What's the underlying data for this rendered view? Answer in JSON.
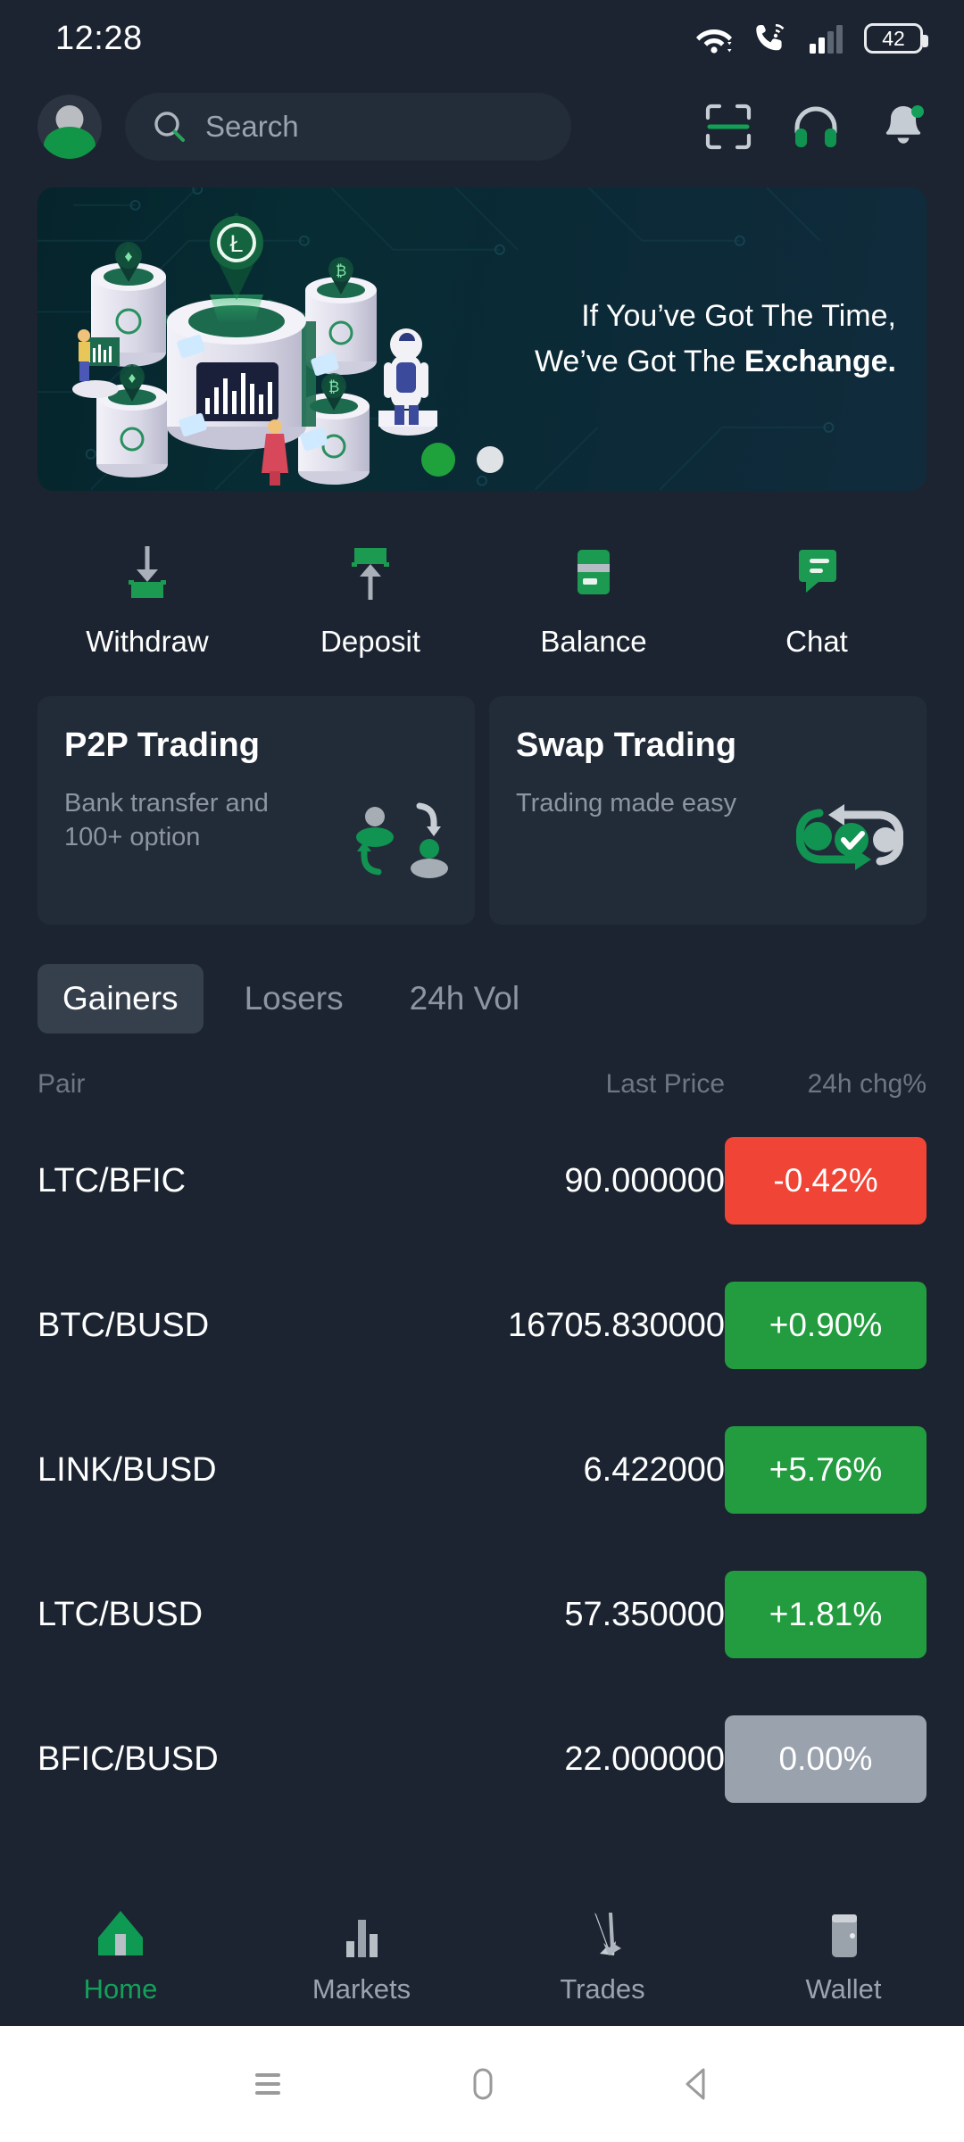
{
  "statusbar": {
    "time": "12:28",
    "battery_level": "42",
    "icons": [
      "wifi-icon",
      "vowifi-call-icon",
      "cellular-signal-icon",
      "battery-icon"
    ]
  },
  "topbar": {
    "avatar": "user-avatar",
    "search": {
      "placeholder": "Search",
      "value": ""
    },
    "actions": [
      {
        "name": "scan-icon",
        "label": "Scan"
      },
      {
        "name": "headphones-support-icon",
        "label": "Support"
      },
      {
        "name": "bell-notification-icon",
        "label": "Notifications",
        "has_badge": true
      }
    ]
  },
  "banner": {
    "line1": "If You’ve Got The Time,",
    "line2_prefix": "We’ve Got The ",
    "line2_strong": "Exchange.",
    "dots": [
      {
        "state": "active",
        "color": "#1fa23c"
      },
      {
        "state": "inactive",
        "color": "#dfe3e6"
      }
    ]
  },
  "quick_actions": [
    {
      "label": "Withdraw",
      "icon": "withdraw-icon"
    },
    {
      "label": "Deposit",
      "icon": "deposit-icon"
    },
    {
      "label": "Balance",
      "icon": "balance-card-icon"
    },
    {
      "label": "Chat",
      "icon": "chat-bubble-icon"
    }
  ],
  "promos": [
    {
      "title": "P2P Trading",
      "subtitle": "Bank transfer and 100+ option",
      "icon": "p2p-exchange-icon"
    },
    {
      "title": "Swap Trading",
      "subtitle": "Trading made easy",
      "icon": "swap-arrows-icon"
    }
  ],
  "market": {
    "tabs": [
      {
        "label": "Gainers",
        "active": true
      },
      {
        "label": "Losers",
        "active": false
      },
      {
        "label": "24h Vol",
        "active": false
      }
    ],
    "columns": {
      "pair": "Pair",
      "price": "Last Price",
      "change": "24h chg%"
    },
    "rows": [
      {
        "pair": "LTC/BFIC",
        "price": "90.000000",
        "change": "-0.42%",
        "dir": "down"
      },
      {
        "pair": "BTC/BUSD",
        "price": "16705.830000",
        "change": "+0.90%",
        "dir": "up"
      },
      {
        "pair": "LINK/BUSD",
        "price": "6.422000",
        "change": "+5.76%",
        "dir": "up"
      },
      {
        "pair": "LTC/BUSD",
        "price": "57.350000",
        "change": "+1.81%",
        "dir": "up"
      },
      {
        "pair": "BFIC/BUSD",
        "price": "22.000000",
        "change": "0.00%",
        "dir": "flat"
      }
    ]
  },
  "bottom_nav": [
    {
      "label": "Home",
      "icon": "home-icon",
      "active": true
    },
    {
      "label": "Markets",
      "icon": "markets-bars-icon",
      "active": false
    },
    {
      "label": "Trades",
      "icon": "trades-arrows-icon",
      "active": false
    },
    {
      "label": "Wallet",
      "icon": "wallet-icon",
      "active": false
    }
  ],
  "android_nav": [
    {
      "icon": "recents-menu-icon"
    },
    {
      "icon": "home-pill-icon"
    },
    {
      "icon": "back-triangle-icon"
    }
  ],
  "colors": {
    "background": "#1b2430",
    "card": "#222c39",
    "accent_green": "#14a05a",
    "badge_up": "#239c3f",
    "badge_down": "#f04436",
    "badge_flat": "#9aa2ad",
    "muted_text": "#8c95a1"
  }
}
